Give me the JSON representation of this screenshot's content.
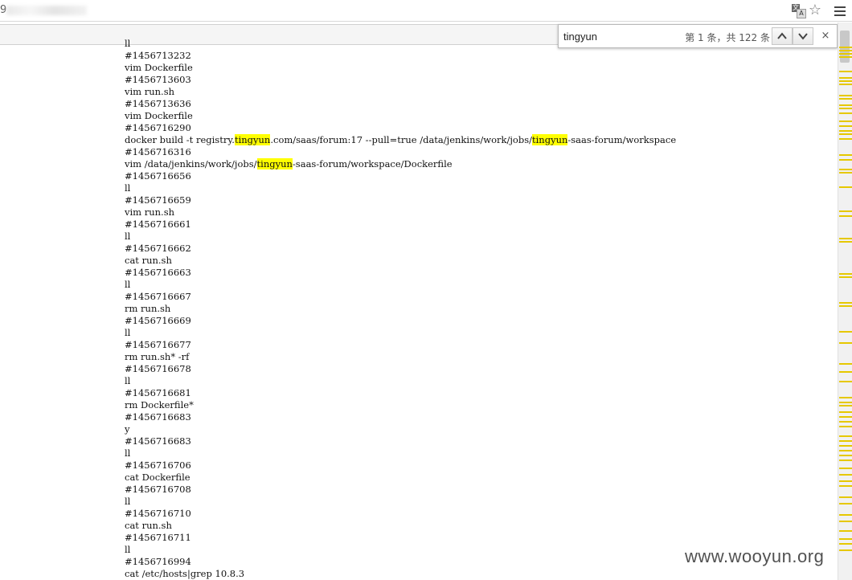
{
  "browser": {
    "url_prefix": "9",
    "find": {
      "query": "tingyun",
      "count_text": "第 1 条，共 122 条",
      "prev_label": "∧",
      "next_label": "∨",
      "close_label": "×"
    },
    "icons": [
      "translate-icon",
      "star-icon",
      "menu-icon",
      "chevron-up-icon",
      "chevron-down-icon",
      "close-icon"
    ]
  },
  "content": {
    "highlight_color": "#ffff00",
    "lines": [
      {
        "text": "ll"
      },
      {
        "text": "#1456713232"
      },
      {
        "text": "vim Dockerfile"
      },
      {
        "text": "#1456713603"
      },
      {
        "text": "vim run.sh"
      },
      {
        "text": "#1456713636"
      },
      {
        "text": "vim Dockerfile"
      },
      {
        "text": "#1456716290"
      },
      {
        "segments": [
          "docker build -t registry.",
          "tingyun",
          ".com/saas/forum:17 --pull=true /data/jenkins/work/jobs/",
          "tingyun",
          "-saas-forum/workspace"
        ]
      },
      {
        "text": "#1456716316"
      },
      {
        "segments": [
          "vim /data/jenkins/work/jobs/",
          "tingyun",
          "-saas-forum/workspace/Dockerfile"
        ]
      },
      {
        "text": "#1456716656"
      },
      {
        "text": "ll"
      },
      {
        "text": "#1456716659"
      },
      {
        "text": "vim run.sh"
      },
      {
        "text": "#1456716661"
      },
      {
        "text": "ll"
      },
      {
        "text": "#1456716662"
      },
      {
        "text": "cat run.sh"
      },
      {
        "text": "#1456716663"
      },
      {
        "text": "ll"
      },
      {
        "text": "#1456716667"
      },
      {
        "text": "rm run.sh"
      },
      {
        "text": "#1456716669"
      },
      {
        "text": "ll"
      },
      {
        "text": "#1456716677"
      },
      {
        "text": "rm run.sh* -rf"
      },
      {
        "text": "#1456716678"
      },
      {
        "text": "ll"
      },
      {
        "text": "#1456716681"
      },
      {
        "text": "rm Dockerfile*"
      },
      {
        "text": "#1456716683"
      },
      {
        "text": "y"
      },
      {
        "text": "#1456716683"
      },
      {
        "text": "ll"
      },
      {
        "text": "#1456716706"
      },
      {
        "text": "cat Dockerfile"
      },
      {
        "text": "#1456716708"
      },
      {
        "text": "ll"
      },
      {
        "text": "#1456716710"
      },
      {
        "text": "cat run.sh"
      },
      {
        "text": "#1456716711"
      },
      {
        "text": "ll"
      },
      {
        "text": "#1456716994"
      },
      {
        "text": "cat /etc/hosts|grep 10.8.3"
      }
    ]
  },
  "watermark": "www.wooyun.org"
}
